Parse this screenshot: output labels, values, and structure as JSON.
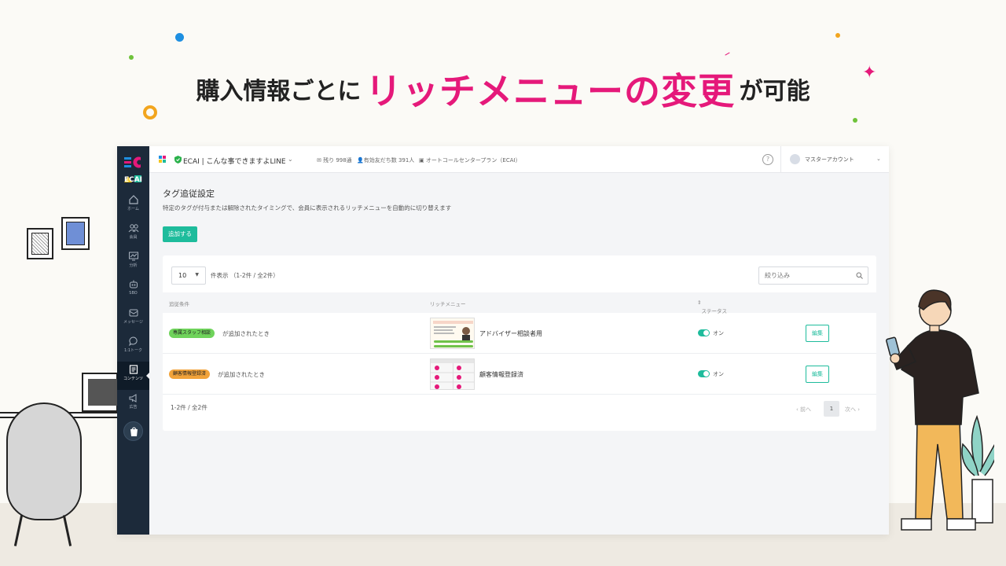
{
  "headline": {
    "pre": "購入情報ごとに",
    "accent": "リッチメニューの変更",
    "post": "が可能"
  },
  "colors": {
    "accent": "#e5197a",
    "primary": "#1ebc9c",
    "sidebar": "#1c2a3a"
  },
  "topbar": {
    "account_name": "ECAI | こんな事できますよLINE",
    "remaining": "残り 998通",
    "friends": "有効友だち数 391人",
    "plan": "オートコールセンタープラン（ECAI）",
    "help": "?",
    "user": "マスターアカウント"
  },
  "sidebar": {
    "logo_text": "ECAI",
    "items": [
      {
        "label": "ホーム",
        "icon": "home-icon"
      },
      {
        "label": "会員",
        "icon": "users-icon"
      },
      {
        "label": "分析",
        "icon": "chart-icon"
      },
      {
        "label": "SBO",
        "icon": "robot-icon"
      },
      {
        "label": "メッセージ",
        "icon": "message-icon"
      },
      {
        "label": "1:1トーク",
        "icon": "chat-icon"
      },
      {
        "label": "コンテンツ",
        "icon": "content-icon",
        "active": true
      },
      {
        "label": "広告",
        "icon": "megaphone-icon"
      }
    ]
  },
  "page": {
    "title": "タグ追従設定",
    "description": "特定のタグが付与または解除されたタイミングで、会員に表示されるリッチメニューを自動的に切り替えます",
    "add_button": "追加する"
  },
  "table": {
    "per_page": "10",
    "count_label": "件表示 （1-2件 / 全2件）",
    "search_placeholder": "絞り込み",
    "headers": {
      "condition": "追従条件",
      "rich_menu": "リッチメニュー",
      "status": "ステータス"
    },
    "rows": [
      {
        "tag": "専属スタッフ相談",
        "tag_color": "#6fd35b",
        "condition": "が追加されたとき",
        "menu": "アドバイザー相談者用",
        "status": "オン",
        "edit": "編集"
      },
      {
        "tag": "顧客情報登録済",
        "tag_color": "#f2a33a",
        "condition": "が追加されたとき",
        "menu": "顧客情報登録済",
        "status": "オン",
        "edit": "編集"
      }
    ],
    "footer_count": "1-2件 / 全2件",
    "prev": "‹ 前へ",
    "page": "1",
    "next": "次へ ›"
  }
}
